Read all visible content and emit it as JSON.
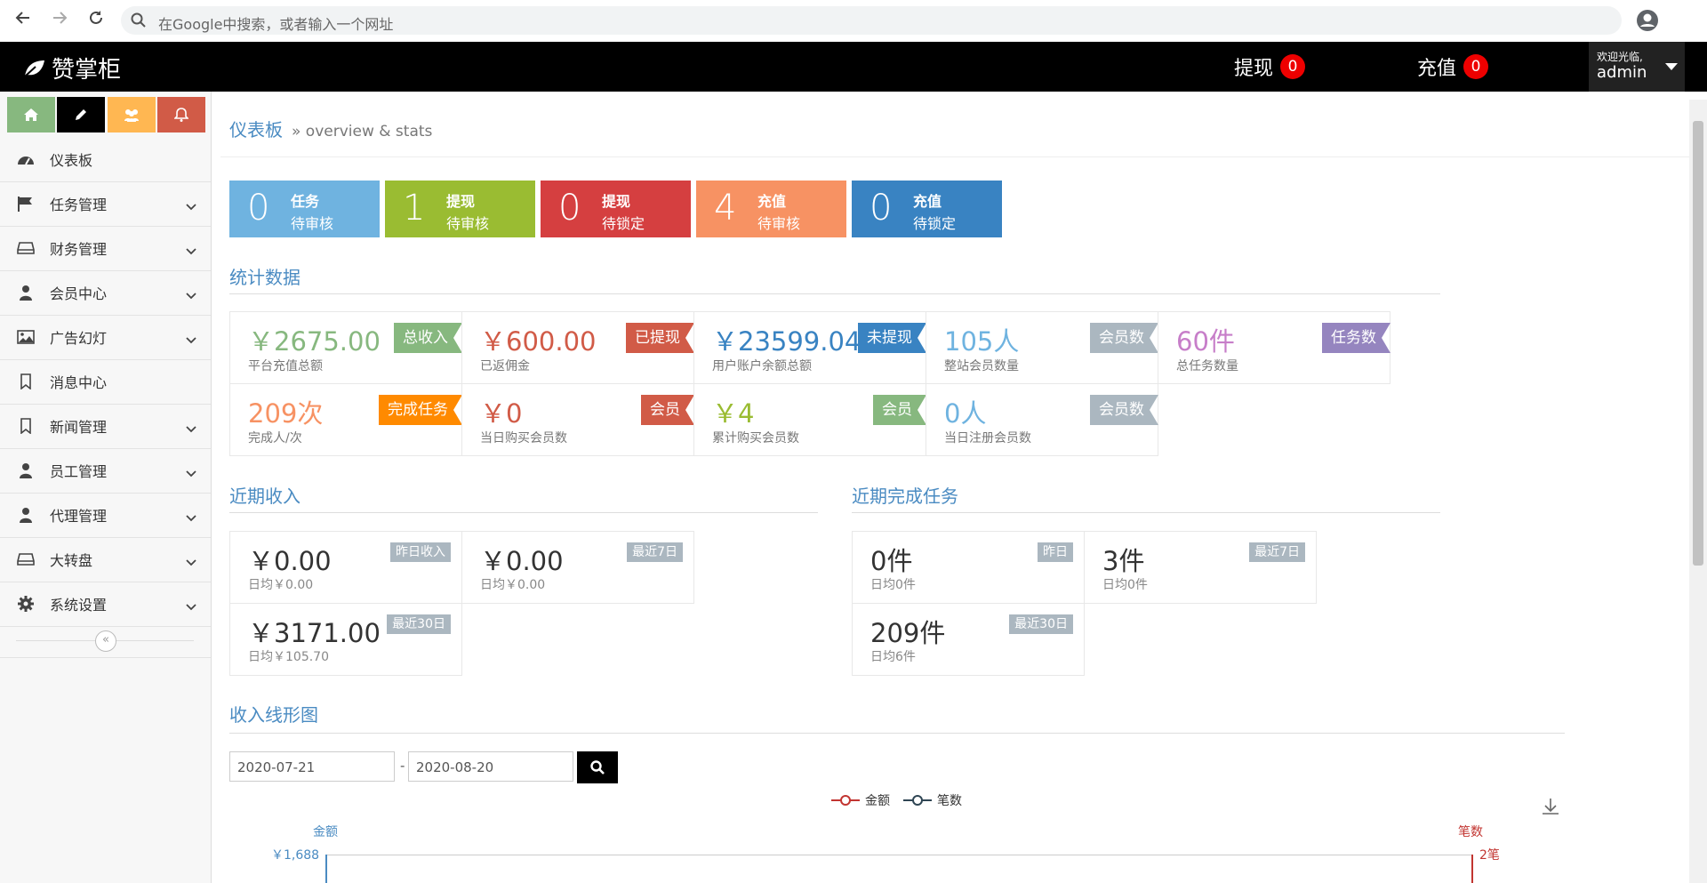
{
  "browser": {
    "omnibox_placeholder": "在Google中搜索，或者输入一个网址"
  },
  "header": {
    "logo": "赞掌柜",
    "withdraw_label": "提现",
    "withdraw_count": "0",
    "recharge_label": "充值",
    "recharge_count": "0",
    "welcome": "欢迎光临,",
    "username": "admin"
  },
  "sidebar": {
    "shortcut_colors": [
      "#87b87f",
      "#000000",
      "#ffb752",
      "#d15b47"
    ],
    "items": [
      {
        "label": "仪表板",
        "icon": "dashboard-icon",
        "expandable": false
      },
      {
        "label": "任务管理",
        "icon": "flag-icon",
        "expandable": true
      },
      {
        "label": "财务管理",
        "icon": "hdd-icon",
        "expandable": true
      },
      {
        "label": "会员中心",
        "icon": "user-icon",
        "expandable": true
      },
      {
        "label": "广告幻灯",
        "icon": "image-icon",
        "expandable": true
      },
      {
        "label": "消息中心",
        "icon": "bookmark-icon",
        "expandable": false
      },
      {
        "label": "新闻管理",
        "icon": "bookmark-icon",
        "expandable": true
      },
      {
        "label": "员工管理",
        "icon": "user-icon",
        "expandable": true
      },
      {
        "label": "代理管理",
        "icon": "user-icon",
        "expandable": true
      },
      {
        "label": "大转盘",
        "icon": "hdd-icon",
        "expandable": true
      },
      {
        "label": "系统设置",
        "icon": "gear-icon",
        "expandable": true
      }
    ]
  },
  "breadcrumb": {
    "title": "仪表板",
    "subtitle": "» overview & stats"
  },
  "tiles": [
    {
      "num": "0",
      "l1": "任务",
      "l2": "待审核",
      "color": "#6fb3e0"
    },
    {
      "num": "1",
      "l1": "提现",
      "l2": "待审核",
      "color": "#9abc32"
    },
    {
      "num": "0",
      "l1": "提现",
      "l2": "待锁定",
      "color": "#d53f40"
    },
    {
      "num": "4",
      "l1": "充值",
      "l2": "待审核",
      "color": "#f79263"
    },
    {
      "num": "0",
      "l1": "充值",
      "l2": "待锁定",
      "color": "#3983c2"
    }
  ],
  "stats_title": "统计数据",
  "stats": [
    {
      "value": "￥2675.00",
      "ribbon": "总收入",
      "sub": "平台充值总额",
      "color": "#87b87f"
    },
    {
      "value": "￥600.00",
      "ribbon": "已提现",
      "sub": "已返佣金",
      "color": "#d15b47"
    },
    {
      "value": "￥23599.04",
      "ribbon": "未提现",
      "sub": "用户账户余额总额",
      "color": "#3983c2"
    },
    {
      "value": "105人",
      "ribbon": "会员数",
      "sub": "整站会员数量",
      "color": "#6fb3e0",
      "ribbon_color": "#abb7c0"
    },
    {
      "value": "60件",
      "ribbon": "任务数",
      "sub": "总任务数量",
      "color": "#c77ec9",
      "ribbon_color": "#9585bf"
    },
    {
      "value": "209次",
      "ribbon": "完成任务",
      "sub": "完成人/次",
      "color": "#f79263",
      "ribbon_color": "#ff8a00"
    },
    {
      "value": "￥0",
      "ribbon": "会员",
      "sub": "当日购买会员数",
      "color": "#d15b47"
    },
    {
      "value": "￥4",
      "ribbon": "会员",
      "sub": "累计购买会员数",
      "color": "#9abc32",
      "ribbon_color": "#87b87f"
    },
    {
      "value": "0人",
      "ribbon": "会员数",
      "sub": "当日注册会员数",
      "color": "#6fb3e0",
      "ribbon_color": "#abb7c0"
    }
  ],
  "income": {
    "title": "近期收入",
    "cards": [
      {
        "value": "￥0.00",
        "tag": "昨日收入",
        "sub": "日均￥0.00"
      },
      {
        "value": "￥0.00",
        "tag": "最近7日",
        "sub": "日均￥0.00"
      },
      {
        "value": "￥3171.00",
        "tag": "最近30日",
        "sub": "日均￥105.70"
      }
    ]
  },
  "tasks": {
    "title": "近期完成任务",
    "cards": [
      {
        "value": "0件",
        "tag": "昨日",
        "sub": "日均0件"
      },
      {
        "value": "3件",
        "tag": "最近7日",
        "sub": "日均0件"
      },
      {
        "value": "209件",
        "tag": "最近30日",
        "sub": "日均6件"
      }
    ]
  },
  "chart_section": {
    "title": "收入线形图",
    "date_from": "2020-07-21",
    "date_sep": "-",
    "date_to": "2020-08-20"
  },
  "chart_data": {
    "type": "line",
    "series": [
      {
        "name": "金额",
        "color": "#c23531"
      },
      {
        "name": "笔数",
        "color": "#2f4554"
      }
    ],
    "ylabel_left": "金额",
    "ylabel_right": "笔数",
    "y_left_top_tick": "￥1,688",
    "y_right_top_tick": "2笔"
  }
}
